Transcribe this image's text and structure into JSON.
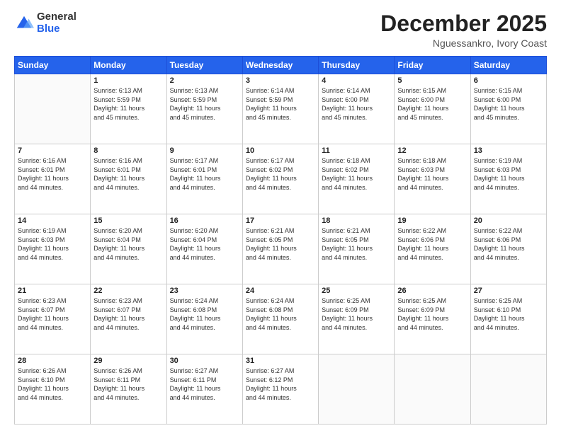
{
  "logo": {
    "general": "General",
    "blue": "Blue"
  },
  "header": {
    "month": "December 2025",
    "location": "Nguessankro, Ivory Coast"
  },
  "days_of_week": [
    "Sunday",
    "Monday",
    "Tuesday",
    "Wednesday",
    "Thursday",
    "Friday",
    "Saturday"
  ],
  "weeks": [
    [
      {
        "day": "",
        "info": ""
      },
      {
        "day": "1",
        "info": "Sunrise: 6:13 AM\nSunset: 5:59 PM\nDaylight: 11 hours\nand 45 minutes."
      },
      {
        "day": "2",
        "info": "Sunrise: 6:13 AM\nSunset: 5:59 PM\nDaylight: 11 hours\nand 45 minutes."
      },
      {
        "day": "3",
        "info": "Sunrise: 6:14 AM\nSunset: 5:59 PM\nDaylight: 11 hours\nand 45 minutes."
      },
      {
        "day": "4",
        "info": "Sunrise: 6:14 AM\nSunset: 6:00 PM\nDaylight: 11 hours\nand 45 minutes."
      },
      {
        "day": "5",
        "info": "Sunrise: 6:15 AM\nSunset: 6:00 PM\nDaylight: 11 hours\nand 45 minutes."
      },
      {
        "day": "6",
        "info": "Sunrise: 6:15 AM\nSunset: 6:00 PM\nDaylight: 11 hours\nand 45 minutes."
      }
    ],
    [
      {
        "day": "7",
        "info": "Sunrise: 6:16 AM\nSunset: 6:01 PM\nDaylight: 11 hours\nand 44 minutes."
      },
      {
        "day": "8",
        "info": "Sunrise: 6:16 AM\nSunset: 6:01 PM\nDaylight: 11 hours\nand 44 minutes."
      },
      {
        "day": "9",
        "info": "Sunrise: 6:17 AM\nSunset: 6:01 PM\nDaylight: 11 hours\nand 44 minutes."
      },
      {
        "day": "10",
        "info": "Sunrise: 6:17 AM\nSunset: 6:02 PM\nDaylight: 11 hours\nand 44 minutes."
      },
      {
        "day": "11",
        "info": "Sunrise: 6:18 AM\nSunset: 6:02 PM\nDaylight: 11 hours\nand 44 minutes."
      },
      {
        "day": "12",
        "info": "Sunrise: 6:18 AM\nSunset: 6:03 PM\nDaylight: 11 hours\nand 44 minutes."
      },
      {
        "day": "13",
        "info": "Sunrise: 6:19 AM\nSunset: 6:03 PM\nDaylight: 11 hours\nand 44 minutes."
      }
    ],
    [
      {
        "day": "14",
        "info": "Sunrise: 6:19 AM\nSunset: 6:03 PM\nDaylight: 11 hours\nand 44 minutes."
      },
      {
        "day": "15",
        "info": "Sunrise: 6:20 AM\nSunset: 6:04 PM\nDaylight: 11 hours\nand 44 minutes."
      },
      {
        "day": "16",
        "info": "Sunrise: 6:20 AM\nSunset: 6:04 PM\nDaylight: 11 hours\nand 44 minutes."
      },
      {
        "day": "17",
        "info": "Sunrise: 6:21 AM\nSunset: 6:05 PM\nDaylight: 11 hours\nand 44 minutes."
      },
      {
        "day": "18",
        "info": "Sunrise: 6:21 AM\nSunset: 6:05 PM\nDaylight: 11 hours\nand 44 minutes."
      },
      {
        "day": "19",
        "info": "Sunrise: 6:22 AM\nSunset: 6:06 PM\nDaylight: 11 hours\nand 44 minutes."
      },
      {
        "day": "20",
        "info": "Sunrise: 6:22 AM\nSunset: 6:06 PM\nDaylight: 11 hours\nand 44 minutes."
      }
    ],
    [
      {
        "day": "21",
        "info": "Sunrise: 6:23 AM\nSunset: 6:07 PM\nDaylight: 11 hours\nand 44 minutes."
      },
      {
        "day": "22",
        "info": "Sunrise: 6:23 AM\nSunset: 6:07 PM\nDaylight: 11 hours\nand 44 minutes."
      },
      {
        "day": "23",
        "info": "Sunrise: 6:24 AM\nSunset: 6:08 PM\nDaylight: 11 hours\nand 44 minutes."
      },
      {
        "day": "24",
        "info": "Sunrise: 6:24 AM\nSunset: 6:08 PM\nDaylight: 11 hours\nand 44 minutes."
      },
      {
        "day": "25",
        "info": "Sunrise: 6:25 AM\nSunset: 6:09 PM\nDaylight: 11 hours\nand 44 minutes."
      },
      {
        "day": "26",
        "info": "Sunrise: 6:25 AM\nSunset: 6:09 PM\nDaylight: 11 hours\nand 44 minutes."
      },
      {
        "day": "27",
        "info": "Sunrise: 6:25 AM\nSunset: 6:10 PM\nDaylight: 11 hours\nand 44 minutes."
      }
    ],
    [
      {
        "day": "28",
        "info": "Sunrise: 6:26 AM\nSunset: 6:10 PM\nDaylight: 11 hours\nand 44 minutes."
      },
      {
        "day": "29",
        "info": "Sunrise: 6:26 AM\nSunset: 6:11 PM\nDaylight: 11 hours\nand 44 minutes."
      },
      {
        "day": "30",
        "info": "Sunrise: 6:27 AM\nSunset: 6:11 PM\nDaylight: 11 hours\nand 44 minutes."
      },
      {
        "day": "31",
        "info": "Sunrise: 6:27 AM\nSunset: 6:12 PM\nDaylight: 11 hours\nand 44 minutes."
      },
      {
        "day": "",
        "info": ""
      },
      {
        "day": "",
        "info": ""
      },
      {
        "day": "",
        "info": ""
      }
    ]
  ]
}
